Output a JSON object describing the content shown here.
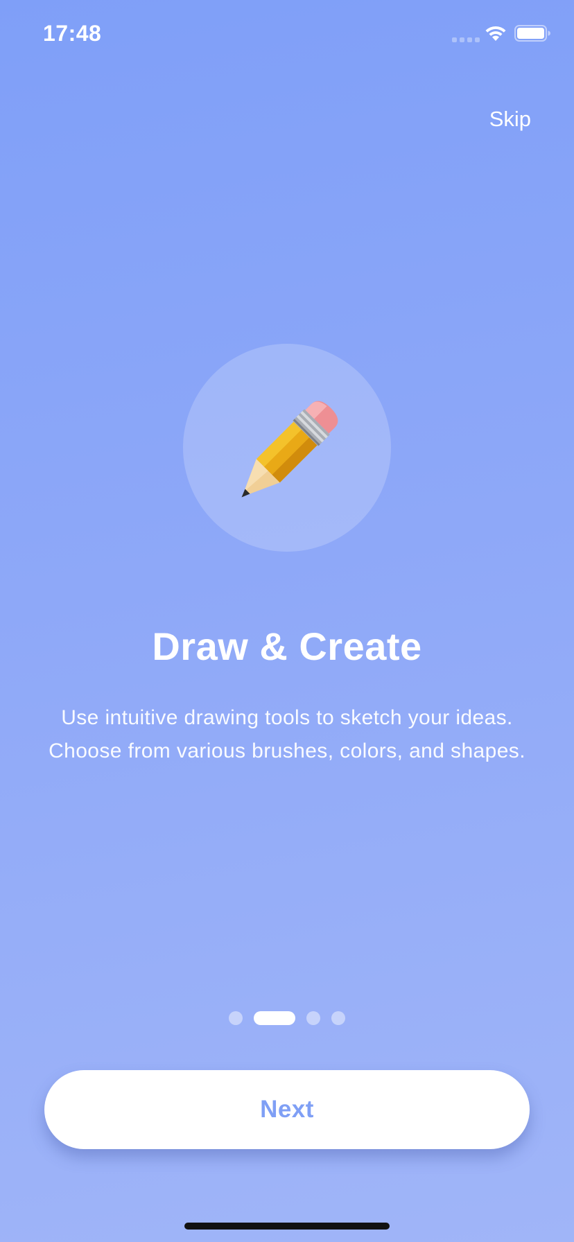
{
  "status_bar": {
    "time": "17:48",
    "icons": [
      "cellular-signal-icon",
      "wifi-icon",
      "battery-icon"
    ]
  },
  "header": {
    "skip_label": "Skip"
  },
  "illustration": {
    "icon": "pencil-icon"
  },
  "content": {
    "title": "Draw & Create",
    "description": "Use intuitive drawing tools to sketch your ideas. Choose from various brushes, colors, and shapes."
  },
  "pagination": {
    "total_pages": 4,
    "current_page": 2
  },
  "footer": {
    "next_label": "Next"
  },
  "colors": {
    "background_top": "#7f9ff8",
    "background_bottom": "#a0b5f8",
    "button_text": "#7f9ff5",
    "button_background": "#ffffff"
  }
}
